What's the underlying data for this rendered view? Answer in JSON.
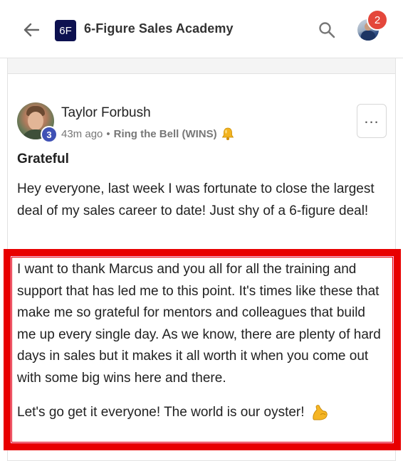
{
  "header": {
    "group_logo_text": "6F",
    "group_title": "6-Figure Sales Academy",
    "notification_count": "2"
  },
  "post": {
    "author_name": "Taylor Forbush",
    "author_level": "3",
    "time_ago": "43m ago",
    "separator": "•",
    "category": "Ring the Bell (WINS)",
    "title": "Grateful",
    "paragraphs": [
      "Hey everyone, last week I was fortunate to close the largest deal of my sales career to date! Just shy of a 6-figure deal!",
      "I want to thank Marcus and you all for all the training and support that has led me to this point. It's times like these that make me so grateful for mentors and colleagues that build me up every single day. As we know, there are plenty of hard days in sales but it makes it all worth it when you come out with some big wins here and there.",
      "Let's go get it everyone! The world is our oyster!"
    ],
    "more_label": "..."
  },
  "icons": {
    "back": "arrow-left-icon",
    "search": "search-icon",
    "bell": "bell-emoji-icon",
    "flexed_arm": "flexed-biceps-emoji-icon"
  },
  "colors": {
    "group_logo_bg": "#0d1150",
    "notification_badge": "#e4473b",
    "level_badge": "#3f51b5",
    "highlight_border": "#e80000"
  }
}
